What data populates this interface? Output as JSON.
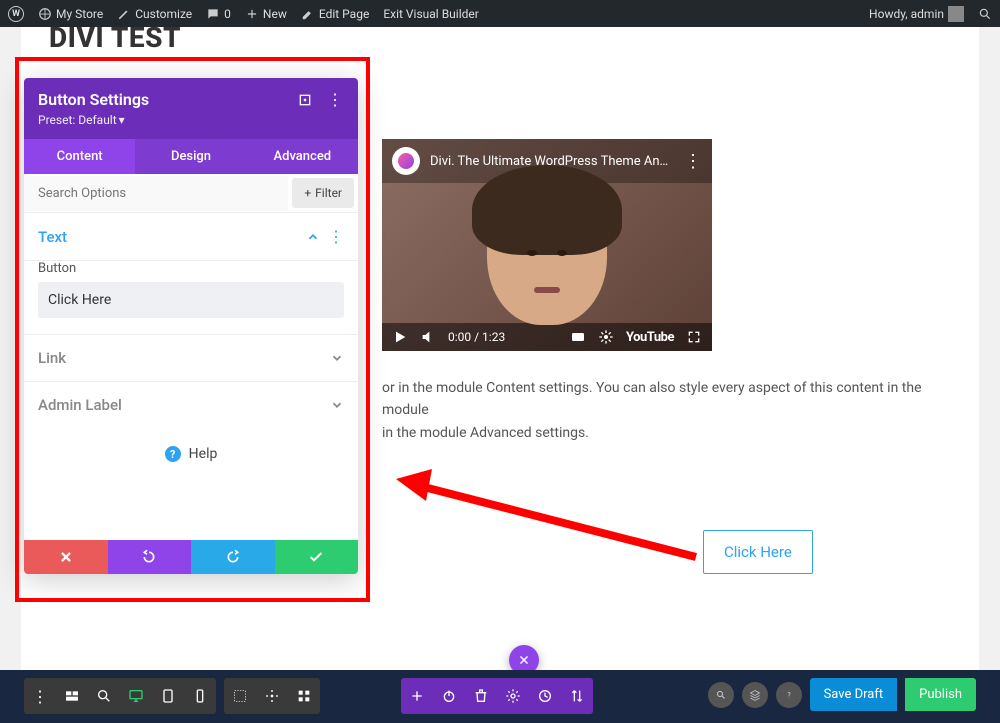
{
  "adminbar": {
    "mystore": "My Store",
    "customize": "Customize",
    "comments": "0",
    "new": "New",
    "editpage": "Edit Page",
    "exitvb": "Exit Visual Builder",
    "howdy": "Howdy, admin"
  },
  "page": {
    "title": "DIVI TEST"
  },
  "panel": {
    "title": "Button Settings",
    "preset": "Preset: Default",
    "tabs": {
      "content": "Content",
      "design": "Design",
      "advanced": "Advanced"
    },
    "search_placeholder": "Search Options",
    "filter": "Filter",
    "section_text": "Text",
    "section_link": "Link",
    "section_admin": "Admin Label",
    "field_button": "Button",
    "field_button_value": "Click Here",
    "help": "Help"
  },
  "video": {
    "title": "Divi. The Ultimate WordPress Theme An…",
    "time": "0:00 / 1:23",
    "brand": "YouTube"
  },
  "content": {
    "line1": "or in the module Content settings. You can also style every aspect of this content in the module",
    "line2": "in the module Advanced settings."
  },
  "button": {
    "label": "Click Here"
  },
  "bottombar": {
    "savedraft": "Save Draft",
    "publish": "Publish"
  }
}
